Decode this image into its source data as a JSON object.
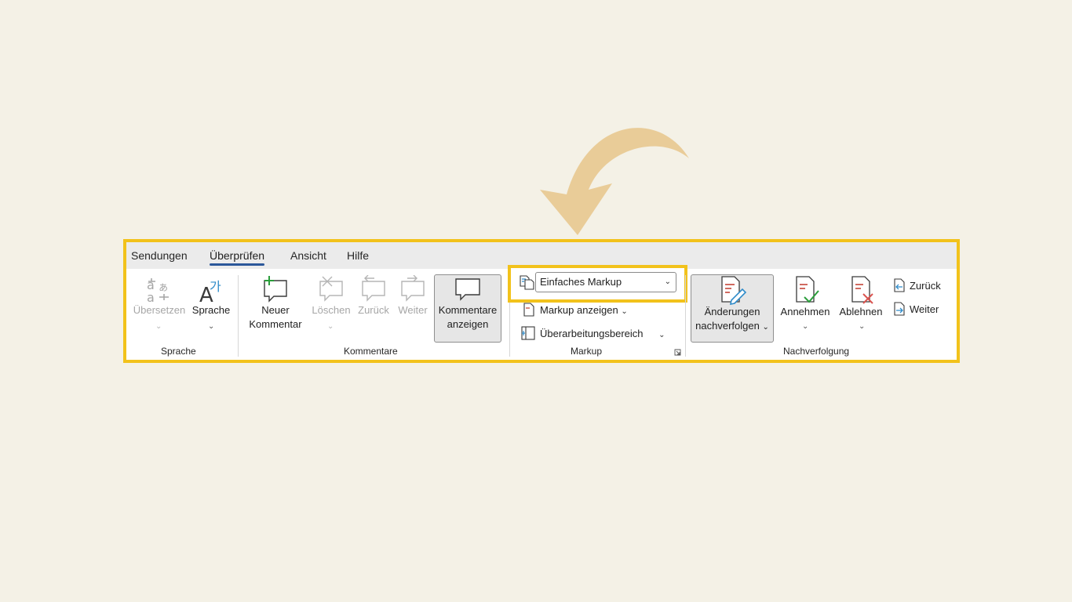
{
  "tabs": [
    "Sendungen",
    "Überprüfen",
    "Ansicht",
    "Hilfe"
  ],
  "active_tab": "Überprüfen",
  "groups": {
    "sprache": {
      "label": "Sprache",
      "translate": "Übersetzen",
      "language": "Sprache"
    },
    "kommentare": {
      "label": "Kommentare",
      "new_line1": "Neuer",
      "new_line2": "Kommentar",
      "delete": "Löschen",
      "back": "Zurück",
      "forward": "Weiter",
      "show_line1": "Kommentare",
      "show_line2": "anzeigen"
    },
    "markup": {
      "label": "Markup",
      "dropdown_value": "Einfaches Markup",
      "show_markup": "Markup anzeigen",
      "review_pane": "Überarbeitungsbereich"
    },
    "nachverfolgung": {
      "label": "Nachverfolgung",
      "track_line1": "Änderungen",
      "track_line2": "nachverfolgen",
      "accept": "Annehmen",
      "reject": "Ablehnen",
      "back": "Zurück",
      "forward": "Weiter"
    }
  },
  "icons": {
    "arrow": "curved-arrow-icon",
    "translate": "translate-icon",
    "language": "language-icon",
    "new_comment": "new-comment-icon",
    "delete_comment": "delete-comment-icon",
    "previous_comment": "previous-comment-icon",
    "next_comment": "next-comment-icon",
    "show_comments": "show-comments-icon",
    "display_for_review": "display-for-review-icon",
    "show_markup": "show-markup-icon",
    "reviewing_pane": "reviewing-pane-icon",
    "track_changes": "track-changes-icon",
    "accept": "accept-icon",
    "reject": "reject-icon",
    "previous_change": "previous-change-icon",
    "next_change": "next-change-icon"
  },
  "colors": {
    "highlight": "#f2c21b",
    "background": "#f4f1e6",
    "arrow": "#e9cc98",
    "accent": "#2b579a"
  }
}
